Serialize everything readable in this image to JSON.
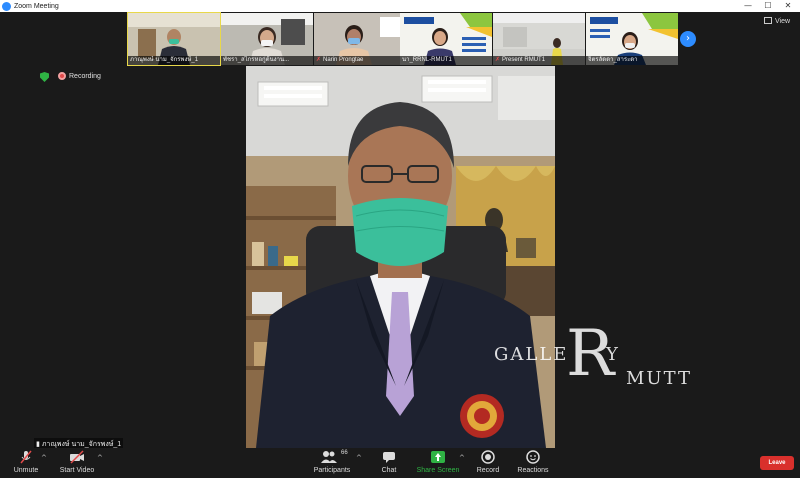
{
  "window": {
    "title": "Zoom Meeting",
    "controls": [
      "—",
      "☐",
      "✕"
    ]
  },
  "top_bar": {
    "view_label": "View"
  },
  "thumbnails": [
    {
      "name": "ภาณุพงษ์ นาม_จักรพงษ์_1",
      "muted": false
    },
    {
      "name": "พัชรา_สไกรหอกู่ต้นงาน...",
      "muted": false
    },
    {
      "name": "Narin Prongtae",
      "muted": true
    },
    {
      "name": "นา_RRNL-RMUT1",
      "muted": false
    },
    {
      "name": "Present RMUT1",
      "muted": true
    },
    {
      "name": "จิตรลัดดา_สาระดา",
      "muted": false
    }
  ],
  "status": {
    "recording_label": "Recording"
  },
  "watermark": {
    "left": "GALLE",
    "big_letter": "R",
    "y": "Y",
    "bottom": "MUTT"
  },
  "local_participant": {
    "name": "ภาณุพงษ์ นาม_จักรพงษ์_1"
  },
  "toolbar": {
    "unmute_label": "Unmute",
    "start_video_label": "Start Video",
    "participants_label": "Participants",
    "participants_count": "66",
    "chat_label": "Chat",
    "share_screen_label": "Share Screen",
    "record_label": "Record",
    "reactions_label": "Reactions",
    "leave_label": "Leave"
  },
  "colors": {
    "accent": "#2d8cff",
    "share_green": "#2fb344",
    "leave_red": "#d9302c",
    "recording_red": "#e24b4b",
    "mask_green": "#3bbf9b"
  }
}
